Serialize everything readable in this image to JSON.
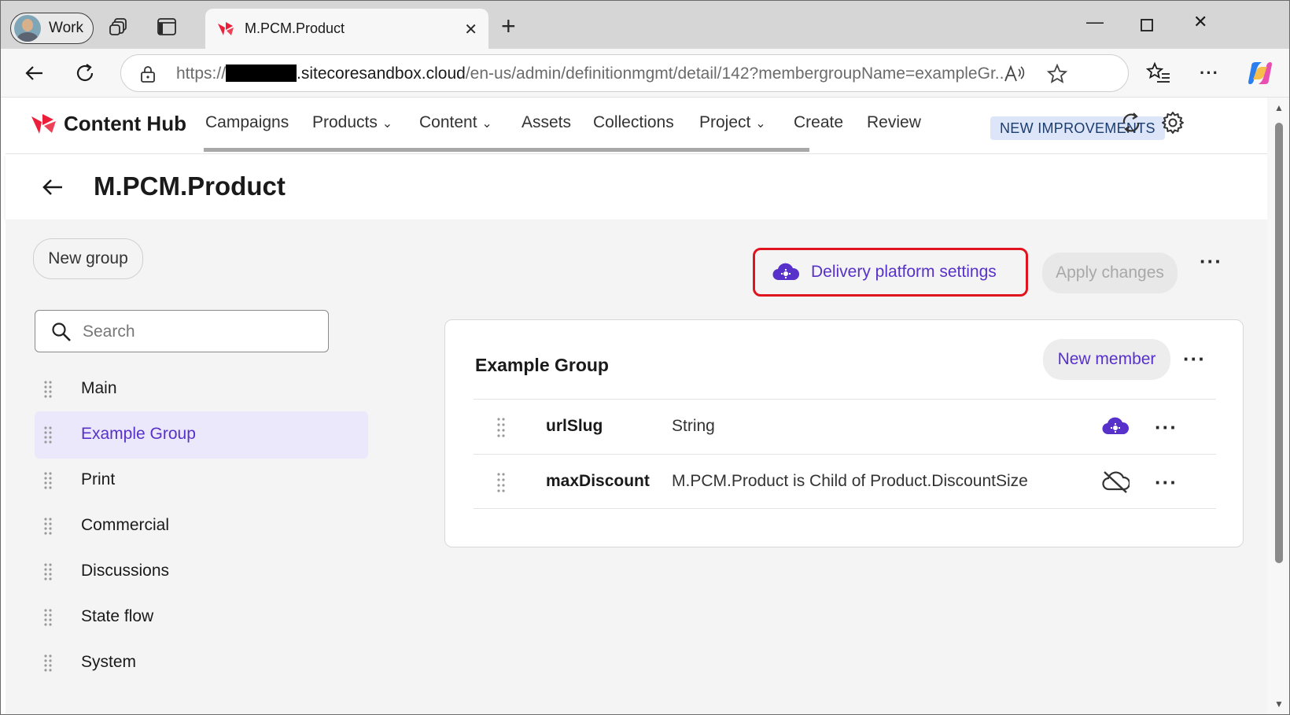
{
  "browser": {
    "profile_label": "Work",
    "tab_title": "M.PCM.Product",
    "url_prefix": "https://",
    "url_domain": ".sitecoresandbox.cloud",
    "url_path": "/en-us/admin/definitionmgmt/detail/142?membergroupName=exampleGr..."
  },
  "app": {
    "brand": "Content Hub",
    "nav": [
      "Campaigns",
      "Products",
      "Content",
      "Assets",
      "Collections",
      "Project",
      "Create",
      "Review"
    ],
    "new_improvements": "NEW IMPROVEMENTS"
  },
  "page": {
    "title": "M.PCM.Product"
  },
  "toolbar": {
    "new_group": "New group",
    "delivery_settings": "Delivery platform settings",
    "apply_changes": "Apply changes"
  },
  "search": {
    "placeholder": "Search"
  },
  "groups": [
    {
      "label": "Main",
      "active": false
    },
    {
      "label": "Example Group",
      "active": true
    },
    {
      "label": "Print",
      "active": false
    },
    {
      "label": "Commercial",
      "active": false
    },
    {
      "label": "Discussions",
      "active": false
    },
    {
      "label": "State flow",
      "active": false
    },
    {
      "label": "System",
      "active": false
    }
  ],
  "card": {
    "title": "Example Group",
    "new_member": "New member",
    "members": [
      {
        "name": "urlSlug",
        "type": "String",
        "cloud_icon": "cloud-gear-icon"
      },
      {
        "name": "maxDiscount",
        "type": "M.PCM.Product is Child of Product.DiscountSize",
        "cloud_icon": "cloud-off-icon"
      }
    ]
  },
  "colors": {
    "accent": "#5731c9",
    "highlight_border": "#e0141e",
    "brand_red": "#eb1f3a"
  }
}
